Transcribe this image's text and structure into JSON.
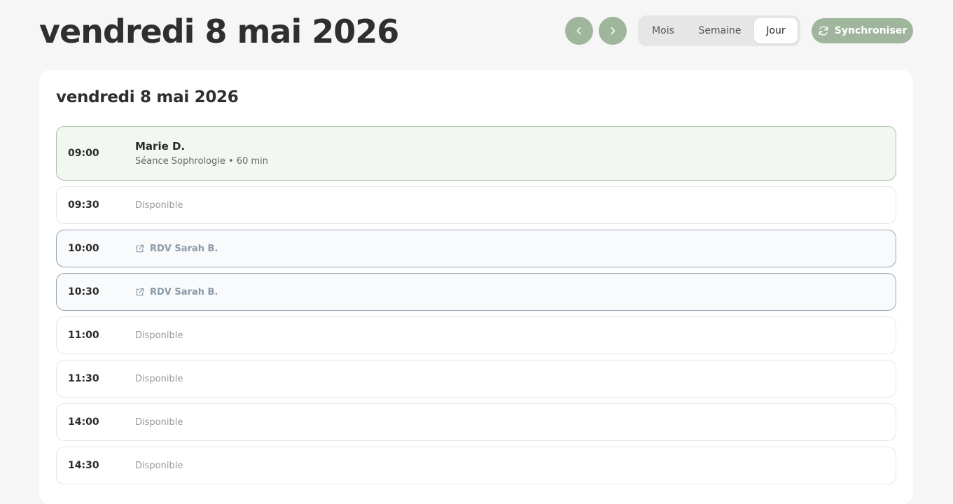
{
  "header": {
    "title": "vendredi 8 mai 2026",
    "prev_icon": "chevron-left-icon",
    "next_icon": "chevron-right-icon",
    "views": [
      {
        "label": "Mois",
        "active": false
      },
      {
        "label": "Semaine",
        "active": false
      },
      {
        "label": "Jour",
        "active": true
      }
    ],
    "sync_label": "Synchroniser",
    "sync_icon": "refresh-icon"
  },
  "colors": {
    "accent": "#9fb59c",
    "background": "#f6f6f6",
    "booked_bg": "#f3f7f2",
    "external_border": "#98a7b5"
  },
  "day": {
    "title": "vendredi 8 mai 2026",
    "slots": [
      {
        "time": "09:00",
        "status": "booked",
        "client": "Marie D.",
        "detail": "Séance Sophrologie • 60 min"
      },
      {
        "time": "09:30",
        "status": "free",
        "label": "Disponible"
      },
      {
        "time": "10:00",
        "status": "external",
        "label": "RDV Sarah B.",
        "icon": "external-link-icon"
      },
      {
        "time": "10:30",
        "status": "external",
        "label": "RDV Sarah B.",
        "icon": "external-link-icon"
      },
      {
        "time": "11:00",
        "status": "free",
        "label": "Disponible"
      },
      {
        "time": "11:30",
        "status": "free",
        "label": "Disponible"
      },
      {
        "time": "14:00",
        "status": "free",
        "label": "Disponible"
      },
      {
        "time": "14:30",
        "status": "free",
        "label": "Disponible"
      }
    ]
  }
}
